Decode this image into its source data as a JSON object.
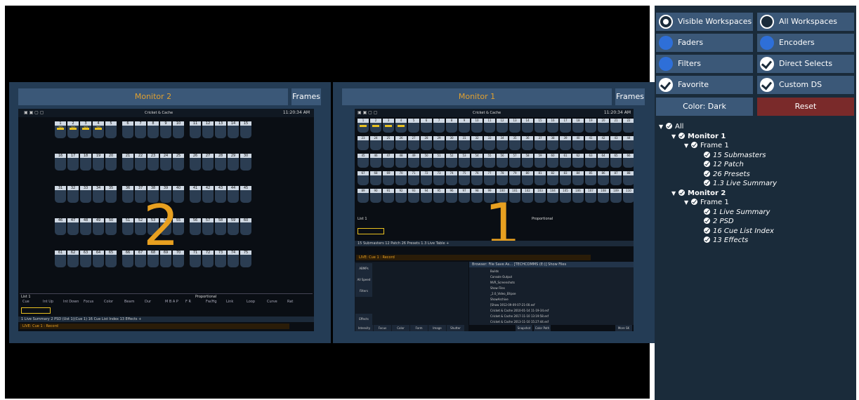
{
  "monitors": [
    {
      "title": "Monitor 2",
      "frames_label": "Frames",
      "number": "2",
      "show_title": "Cricket & Cache",
      "clock": "11:20:34 AM",
      "tabs": "1 Live Summary   2 PSD (Ust 1)(Cue 1)   16 Cue List Index   13 Effects   +",
      "command": "LIVE: Cue 1 : Record",
      "footer_label": "List 1",
      "proportional": "Proportional",
      "param_headers": [
        "Cue",
        "Int Up",
        "Int Down",
        "Focus",
        "Color",
        "Beam",
        "Dur",
        "M B A P",
        "F R",
        "Fw/Hg",
        "Link",
        "Loop",
        "Curve",
        "Rat"
      ],
      "rows": [
        [
          "1",
          "2",
          "3",
          "4",
          "5",
          "6",
          "7",
          "8",
          "9",
          "10",
          "11",
          "12",
          "13",
          "14",
          "15"
        ],
        [
          "16",
          "17",
          "18",
          "19",
          "20",
          "21",
          "22",
          "23",
          "24",
          "25",
          "26",
          "27",
          "28",
          "29",
          "30"
        ],
        [
          "31",
          "32",
          "33",
          "34",
          "35",
          "36",
          "37",
          "38",
          "39",
          "40",
          "41",
          "42",
          "43",
          "44",
          "45"
        ],
        [
          "46",
          "47",
          "48",
          "49",
          "50",
          "51",
          "52",
          "53",
          "54",
          "55",
          "56",
          "57",
          "58",
          "59",
          "60"
        ],
        [
          "61",
          "62",
          "63",
          "64",
          "65",
          "66",
          "67",
          "68",
          "69",
          "70",
          "71",
          "72",
          "73",
          "74",
          "75"
        ]
      ],
      "lit_values": [
        "70",
        "30",
        "30",
        "70"
      ]
    },
    {
      "title": "Monitor 1",
      "frames_label": "Frames",
      "number": "1",
      "show_title": "Cricket & Cache",
      "clock": "11:20:34 AM",
      "tabs": "15 Submasters   12 Patch   26 Presets   1.3 Live Table   +",
      "command": "LIVE: Cue 1 : Record",
      "footer_label": "List 1",
      "proportional": "Proportional",
      "browser_title": "Browser: File Save As... [TECHCOMMS (E:)] Show Files",
      "browser_items": [
        "Builds",
        "Console Output",
        "NVR_Screenshots",
        "Show Files",
        "_2.0_Video_Ellipse",
        "ShowArchive",
        "[Show 1912-09-09 07-21-00.esf",
        "Cricket & Cache 2010-01-14 11-19-34.esf",
        "Cricket & Cache 2017-11-10 13:19:58.esf",
        "Cricket & Cache 2013-11-10 15:27:44.esf"
      ],
      "bottom_buttons": [
        "Intensity",
        "Focus",
        "Color",
        "Form",
        "Image",
        "Shutter"
      ],
      "left_buttons": [
        "ABMPs",
        "All Speed",
        "Filters",
        "Effects"
      ],
      "softkeys": [
        "Snapshot",
        "Color Path",
        "More SK"
      ]
    }
  ],
  "panel": {
    "visible_workspaces": "Visible Workspaces",
    "all_workspaces": "All Workspaces",
    "faders": "Faders",
    "encoders": "Encoders",
    "filters": "Filters",
    "direct_selects": "Direct Selects",
    "favorite": "Favorite",
    "custom_ds": "Custom DS",
    "color": "Color: Dark",
    "reset": "Reset"
  },
  "tree": [
    {
      "label": "All",
      "level": 0,
      "style": "normal",
      "toggle": "▼"
    },
    {
      "label": "Monitor 1",
      "level": 1,
      "style": "bold",
      "toggle": "▼"
    },
    {
      "label": "Frame 1",
      "level": 2,
      "style": "normal",
      "toggle": "▼"
    },
    {
      "label": "15 Submasters",
      "level": 3,
      "style": "italic",
      "toggle": ""
    },
    {
      "label": "12 Patch",
      "level": 3,
      "style": "italic",
      "toggle": ""
    },
    {
      "label": "26 Presets",
      "level": 3,
      "style": "italic",
      "toggle": ""
    },
    {
      "label": "1.3 Live Summary",
      "level": 3,
      "style": "italic",
      "toggle": ""
    },
    {
      "label": "Monitor 2",
      "level": 1,
      "style": "bold",
      "toggle": "▼"
    },
    {
      "label": "Frame 1",
      "level": 2,
      "style": "normal",
      "toggle": "▼"
    },
    {
      "label": "1 Live Summary",
      "level": 3,
      "style": "italic",
      "toggle": ""
    },
    {
      "label": "2 PSD",
      "level": 3,
      "style": "italic",
      "toggle": ""
    },
    {
      "label": "16 Cue List Index",
      "level": 3,
      "style": "italic",
      "toggle": ""
    },
    {
      "label": "13 Effects",
      "level": 3,
      "style": "italic",
      "toggle": ""
    }
  ],
  "colors": {
    "accent": "#e8a020",
    "reset": "#7a2a2a",
    "button": "#3b5878"
  }
}
